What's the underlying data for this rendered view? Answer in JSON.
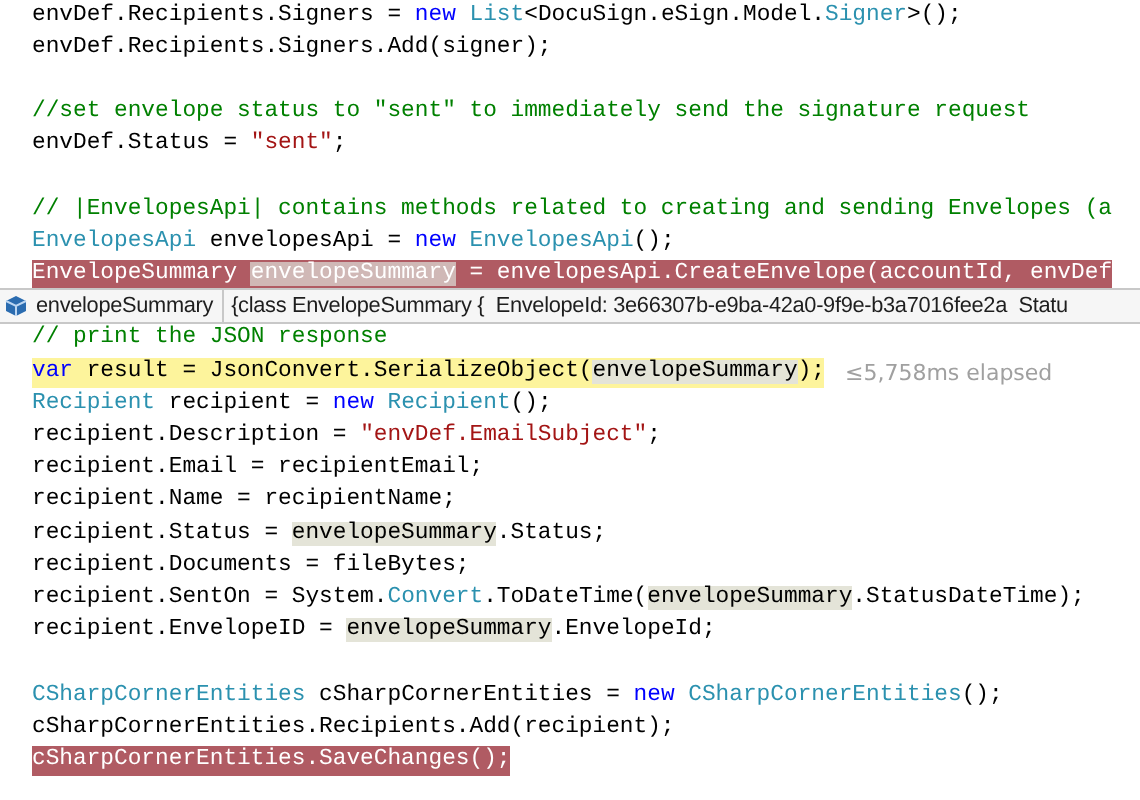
{
  "editor": {
    "lines": [
      {
        "kind": "code",
        "breakpoint": false,
        "current": false,
        "segments": [
          {
            "text": "envDef.Recipients.Signers = ",
            "kind": "plain"
          },
          {
            "text": "new",
            "kind": "keyword"
          },
          {
            "text": " List",
            "kind": "type"
          },
          {
            "text": "<DocuSign.eSign.Model.",
            "kind": "plain"
          },
          {
            "text": "Signer",
            "kind": "type"
          },
          {
            "text": ">();",
            "kind": "plain"
          }
        ]
      },
      {
        "kind": "code",
        "breakpoint": false,
        "current": false,
        "segments": [
          {
            "text": "envDef.Recipients.Signers.Add(signer);",
            "kind": "plain"
          }
        ]
      },
      {
        "kind": "blank"
      },
      {
        "kind": "code",
        "breakpoint": false,
        "current": false,
        "segments": [
          {
            "text": "//set envelope status to \"sent\" to immediately send the signature request",
            "kind": "comment"
          }
        ]
      },
      {
        "kind": "code",
        "breakpoint": false,
        "current": false,
        "segments": [
          {
            "text": "envDef.Status = ",
            "kind": "plain"
          },
          {
            "text": "\"sent\"",
            "kind": "string"
          },
          {
            "text": ";",
            "kind": "plain"
          }
        ]
      },
      {
        "kind": "blank"
      },
      {
        "kind": "code",
        "breakpoint": false,
        "current": false,
        "segments": [
          {
            "text": "// |EnvelopesApi| contains methods related to creating and sending Envelopes (a",
            "kind": "comment"
          }
        ]
      },
      {
        "kind": "code",
        "breakpoint": false,
        "current": false,
        "segments": [
          {
            "text": "EnvelopesApi",
            "kind": "type"
          },
          {
            "text": " envelopesApi = ",
            "kind": "plain"
          },
          {
            "text": "new",
            "kind": "keyword"
          },
          {
            "text": " EnvelopesApi",
            "kind": "type"
          },
          {
            "text": "();",
            "kind": "plain"
          }
        ]
      },
      {
        "kind": "code",
        "breakpoint": true,
        "current": false,
        "segments": [
          {
            "text": "EnvelopeSummary ",
            "kind": "plain"
          },
          {
            "text": "envelopeSummary",
            "kind": "reference"
          },
          {
            "text": " = envelopesApi.CreateEnvelope(accountId, envDef",
            "kind": "plain"
          }
        ]
      },
      {
        "kind": "blank"
      },
      {
        "kind": "code",
        "breakpoint": false,
        "current": false,
        "segments": [
          {
            "text": "// print the JSON response",
            "kind": "comment"
          }
        ]
      },
      {
        "kind": "code",
        "breakpoint": false,
        "current": true,
        "elapsed": "≤5,758ms elapsed",
        "segments": [
          {
            "text": "var",
            "kind": "keyword"
          },
          {
            "text": " result = JsonConvert.SerializeObject(",
            "kind": "plain"
          },
          {
            "text": "envelopeSummary",
            "kind": "reference"
          },
          {
            "text": ");",
            "kind": "plain"
          }
        ]
      },
      {
        "kind": "code",
        "breakpoint": false,
        "current": false,
        "segments": [
          {
            "text": "Recipient",
            "kind": "type"
          },
          {
            "text": " recipient = ",
            "kind": "plain"
          },
          {
            "text": "new",
            "kind": "keyword"
          },
          {
            "text": " Recipient",
            "kind": "type"
          },
          {
            "text": "();",
            "kind": "plain"
          }
        ]
      },
      {
        "kind": "code",
        "breakpoint": false,
        "current": false,
        "segments": [
          {
            "text": "recipient.Description = ",
            "kind": "plain"
          },
          {
            "text": "\"envDef.EmailSubject\"",
            "kind": "string"
          },
          {
            "text": ";",
            "kind": "plain"
          }
        ]
      },
      {
        "kind": "code",
        "breakpoint": false,
        "current": false,
        "segments": [
          {
            "text": "recipient.Email = recipientEmail;",
            "kind": "plain"
          }
        ]
      },
      {
        "kind": "code",
        "breakpoint": false,
        "current": false,
        "segments": [
          {
            "text": "recipient.Name = recipientName;",
            "kind": "plain"
          }
        ]
      },
      {
        "kind": "code",
        "breakpoint": false,
        "current": false,
        "segments": [
          {
            "text": "recipient.Status = ",
            "kind": "plain"
          },
          {
            "text": "envelopeSummary",
            "kind": "reference"
          },
          {
            "text": ".Status;",
            "kind": "plain"
          }
        ]
      },
      {
        "kind": "code",
        "breakpoint": false,
        "current": false,
        "segments": [
          {
            "text": "recipient.Documents = fileBytes;",
            "kind": "plain"
          }
        ]
      },
      {
        "kind": "code",
        "breakpoint": false,
        "current": false,
        "segments": [
          {
            "text": "recipient.SentOn = System.",
            "kind": "plain"
          },
          {
            "text": "Convert",
            "kind": "type"
          },
          {
            "text": ".ToDateTime(",
            "kind": "plain"
          },
          {
            "text": "envelopeSummary",
            "kind": "reference"
          },
          {
            "text": ".StatusDateTime);",
            "kind": "plain"
          }
        ]
      },
      {
        "kind": "code",
        "breakpoint": false,
        "current": false,
        "segments": [
          {
            "text": "recipient.EnvelopeID = ",
            "kind": "plain"
          },
          {
            "text": "envelopeSummary",
            "kind": "reference"
          },
          {
            "text": ".EnvelopeId;",
            "kind": "plain"
          }
        ]
      },
      {
        "kind": "blank"
      },
      {
        "kind": "code",
        "breakpoint": false,
        "current": false,
        "segments": [
          {
            "text": "CSharpCornerEntities",
            "kind": "type"
          },
          {
            "text": " cSharpCornerEntities = ",
            "kind": "plain"
          },
          {
            "text": "new",
            "kind": "keyword"
          },
          {
            "text": " CSharpCornerEntities",
            "kind": "type"
          },
          {
            "text": "();",
            "kind": "plain"
          }
        ]
      },
      {
        "kind": "code",
        "breakpoint": false,
        "current": false,
        "segments": [
          {
            "text": "cSharpCornerEntities.Recipients.Add(recipient);",
            "kind": "plain"
          }
        ]
      },
      {
        "kind": "code",
        "breakpoint": true,
        "current": false,
        "segments": [
          {
            "text": "cSharpCornerEntities.SaveChanges();",
            "kind": "plain"
          }
        ]
      }
    ]
  },
  "datatip": {
    "name": "envelopeSummary",
    "value": "{class EnvelopeSummary {  EnvelopeId: 3e66307b-e9ba-42a0-9f9e-b3a7016fee2a  Statu"
  }
}
